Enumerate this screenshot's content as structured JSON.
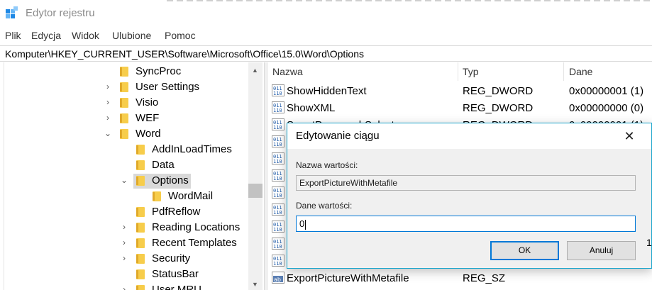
{
  "window": {
    "title": "Edytor rejestru"
  },
  "menu": [
    "Plik",
    "Edycja",
    "Widok",
    "Ulubione",
    "Pomoc"
  ],
  "address": "Komputer\\HKEY_CURRENT_USER\\Software\\Microsoft\\Office\\15.0\\Word\\Options",
  "tree": {
    "items": [
      {
        "label": "SyncProc",
        "expander": "none"
      },
      {
        "label": "User Settings",
        "expander": "collapsed"
      },
      {
        "label": "Visio",
        "expander": "collapsed"
      },
      {
        "label": "WEF",
        "expander": "collapsed"
      },
      {
        "label": "Word",
        "expander": "expanded"
      },
      {
        "label": "AddInLoadTimes",
        "expander": "none"
      },
      {
        "label": "Data",
        "expander": "none"
      },
      {
        "label": "Options",
        "expander": "expanded",
        "selected": true
      },
      {
        "label": "WordMail",
        "expander": "none"
      },
      {
        "label": "PdfReflow",
        "expander": "none"
      },
      {
        "label": "Reading Locations",
        "expander": "collapsed"
      },
      {
        "label": "Recent Templates",
        "expander": "collapsed"
      },
      {
        "label": "Security",
        "expander": "collapsed"
      },
      {
        "label": "StatusBar",
        "expander": "none"
      },
      {
        "label": "User MRU",
        "expander": "collapsed"
      }
    ]
  },
  "list": {
    "columns": [
      "Nazwa",
      "Typ",
      "Dane"
    ],
    "rows": [
      {
        "name": "ShowHiddenText",
        "type": "REG_DWORD",
        "data": "0x00000001 (1)",
        "icon": "binary-value-icon"
      },
      {
        "name": "ShowXML",
        "type": "REG_DWORD",
        "data": "0x00000000 (0)",
        "icon": "binary-value-icon"
      },
      {
        "name": "SmartParagraphSelect",
        "type": "REG_DWORD",
        "data": "0x00000001 (1)",
        "icon": "binary-value-icon"
      },
      {
        "name": "",
        "type": "",
        "data": "",
        "icon": "binary-value-icon"
      },
      {
        "name": "",
        "type": "",
        "data": "",
        "icon": "binary-value-icon"
      },
      {
        "name": "",
        "type": "",
        "data": "",
        "icon": "binary-value-icon"
      },
      {
        "name": "",
        "type": "",
        "data": "",
        "icon": "binary-value-icon"
      },
      {
        "name": "",
        "type": "",
        "data": "",
        "icon": "binary-value-icon"
      },
      {
        "name": "",
        "type": "",
        "data": "",
        "icon": "binary-value-icon"
      },
      {
        "name": "",
        "type": "",
        "data": "",
        "icon": "binary-value-icon"
      },
      {
        "name": "",
        "type": "",
        "data": "",
        "icon": "binary-value-icon"
      },
      {
        "name": "ExportPictureWithMetafile",
        "type": "REG_SZ",
        "data": "",
        "icon": "string-value-icon"
      }
    ]
  },
  "dialog": {
    "title": "Edytowanie ciągu",
    "name_label": "Nazwa wartości:",
    "name_value": "ExportPictureWithMetafile",
    "data_label": "Dane wartości:",
    "data_value": "0",
    "ok": "OK",
    "cancel": "Anuluj",
    "edge_text": "1"
  },
  "colors": {
    "accent": "#0078d7",
    "dialog_border": "#1aa5cc",
    "folder": "#f7cd4b"
  }
}
